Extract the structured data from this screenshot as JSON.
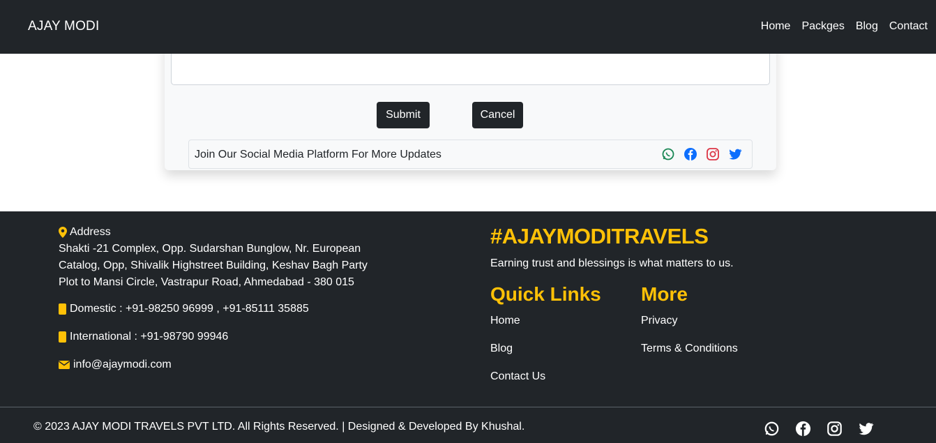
{
  "navbar": {
    "brand": "AJAY MODI",
    "links": [
      "Home",
      "Packges",
      "Blog",
      "Contact"
    ]
  },
  "form": {
    "message_value": "",
    "submit_label": "Submit",
    "cancel_label": "Cancel",
    "social_text": "Join Our Social Media Platform For More Updates",
    "social_icons": [
      "whatsapp-icon",
      "facebook-icon",
      "instagram-icon",
      "twitter-icon"
    ]
  },
  "footer": {
    "address_label": "Address",
    "address_lines": [
      "Shakti -21 Complex, Opp. Sudarshan Bunglow, Nr. European",
      "Catalog, Opp, Shivalik Highstreet Building, Keshav Bagh Party",
      "Plot to Mansi Circle, Vastrapur Road, Ahmedabad - 380 015"
    ],
    "domestic": "Domestic : +91-98250 96999 , +91-85111 35885",
    "international": "International : +91-98790 99946",
    "email": "info@ajaymodi.com",
    "hashtag": "#AJAYMODITRAVELS",
    "tagline": "Earning trust and blessings is what matters to us.",
    "quick_links_title": "Quick Links",
    "quick_links": [
      "Home",
      "Blog",
      "Contact Us"
    ],
    "more_title": "More",
    "more_links": [
      "Privacy",
      "Terms & Conditions"
    ],
    "copyright": "© 2023 AJAY MODI TRAVELS PVT LTD. All Rights Reserved. | Designed & Developed By Khushal."
  },
  "colors": {
    "dark": "#212529",
    "accent": "#ffc107",
    "whatsapp": "#198754",
    "facebook": "#0d6efd",
    "instagram": "#dc3545",
    "twitter": "#0d6efd"
  }
}
